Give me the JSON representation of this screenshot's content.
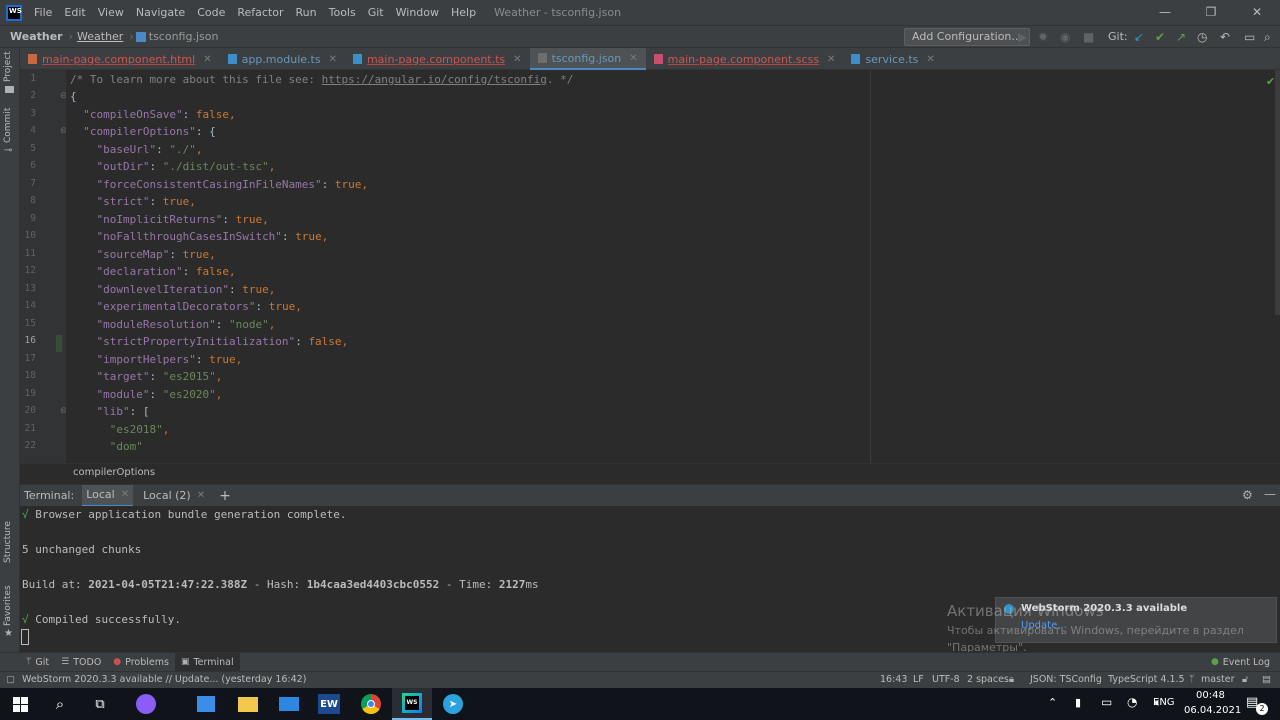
{
  "window": {
    "title": "Weather - tsconfig.json",
    "menu": [
      "File",
      "Edit",
      "View",
      "Navigate",
      "Code",
      "Refactor",
      "Run",
      "Tools",
      "Git",
      "Window",
      "Help"
    ],
    "controls": {
      "minimize": "—",
      "maximize": "❐",
      "close": "✕"
    }
  },
  "navbar": {
    "project": "Weather",
    "folder": "Weather",
    "file": "tsconfig.json",
    "add_config": "Add Configuration...",
    "git_label": "Git:"
  },
  "tabs": [
    {
      "label": "main-page.component.html",
      "style": "red"
    },
    {
      "label": "app.module.ts",
      "style": "blue"
    },
    {
      "label": "main-page.component.ts",
      "style": "red"
    },
    {
      "label": "tsconfig.json",
      "style": "active"
    },
    {
      "label": "main-page.component.scss",
      "style": "red"
    },
    {
      "label": "service.ts",
      "style": "blue"
    }
  ],
  "side_labels": {
    "project": "Project",
    "commit": "Commit",
    "structure": "Structure",
    "favorites": "Favorites"
  },
  "editor": {
    "line_numbers": [
      "1",
      "2",
      "3",
      "4",
      "5",
      "6",
      "7",
      "8",
      "9",
      "10",
      "11",
      "12",
      "13",
      "14",
      "15",
      "16",
      "17",
      "18",
      "19",
      "20",
      "21",
      "22"
    ],
    "current_line": "16",
    "lines": {
      "l1_comment": "/* To learn more about this file see: ",
      "l1_link": "https://angular.io/config/tsconfig",
      "l1_end": ". */",
      "l2": "{",
      "l3_key": "\"compileOnSave\"",
      "l3_val": "false",
      "l4_key": "\"compilerOptions\"",
      "l4_val": "{",
      "l5_key": "\"baseUrl\"",
      "l5_val": "\"./\"",
      "l6_key": "\"outDir\"",
      "l6_val": "\"./dist/out-tsc\"",
      "l7_key": "\"forceConsistentCasingInFileNames\"",
      "l7_val": "true",
      "l8_key": "\"strict\"",
      "l8_val": "true",
      "l9_key": "\"noImplicitReturns\"",
      "l9_val": "true",
      "l10_key": "\"noFallthroughCasesInSwitch\"",
      "l10_val": "true",
      "l11_key": "\"sourceMap\"",
      "l11_val": "true",
      "l12_key": "\"declaration\"",
      "l12_val": "false",
      "l13_key": "\"downlevelIteration\"",
      "l13_val": "true",
      "l14_key": "\"experimentalDecorators\"",
      "l14_val": "true",
      "l15_key": "\"moduleResolution\"",
      "l15_val": "\"node\"",
      "l16_key": "\"strictPropertyInitialization\"",
      "l16_val": "false",
      "l17_key": "\"importHelpers\"",
      "l17_val": "true",
      "l18_key": "\"target\"",
      "l18_val": "\"es2015\"",
      "l19_key": "\"module\"",
      "l19_val": "\"es2020\"",
      "l20_key": "\"lib\"",
      "l20_val": "[",
      "l21": "\"es2018\"",
      "l22": "\"dom\""
    },
    "breadcrumb": "compilerOptions"
  },
  "terminal": {
    "label": "Terminal:",
    "tabs": [
      "Local",
      "Local (2)"
    ],
    "add": "+",
    "lines": {
      "check1": "√",
      "bundle": " Browser application bundle generation complete.",
      "chunks": "5 unchanged chunks",
      "build_at_label": "Build at: ",
      "build_at": "2021-04-05T21:47:22.388Z",
      "hash_label": " - Hash: ",
      "hash": "1b4caa3ed4403cbc0552",
      "time_label": " - Time: ",
      "time": "2127",
      "time_unit": "ms",
      "check2": "√",
      "compiled": " Compiled successfully."
    }
  },
  "watermark": {
    "title": "Активация Windows",
    "line1": "Чтобы активировать Windows, перейдите в раздел",
    "line2": "\"Параметры\"."
  },
  "notification": {
    "title": "WebStorm 2020.3.3 available",
    "link": "Update..."
  },
  "tool_windows": [
    {
      "label": "Git",
      "icon": "branch-icon"
    },
    {
      "label": "TODO",
      "icon": "list-icon"
    },
    {
      "label": "Problems",
      "icon": "error-icon"
    },
    {
      "label": "Terminal",
      "icon": "terminal-icon"
    }
  ],
  "event_log": "Event Log",
  "status": {
    "message": "WebStorm 2020.3.3 available // Update... (yesterday 16:42)",
    "position": "16:43",
    "line_sep": "LF",
    "encoding": "UTF-8",
    "indent": "2 spaces",
    "schema": "JSON: TSConfig",
    "ts_version": "TypeScript 4.1.5",
    "branch": "master"
  },
  "taskbar": {
    "lang": "ENG",
    "time": "00:48",
    "date": "06.04.2021",
    "notif_count": "2"
  },
  "colors": {
    "accent": "#4a88c7",
    "keyword": "#9876aa",
    "string": "#6a8759",
    "value": "#cc7832",
    "success": "#5aa04a"
  }
}
